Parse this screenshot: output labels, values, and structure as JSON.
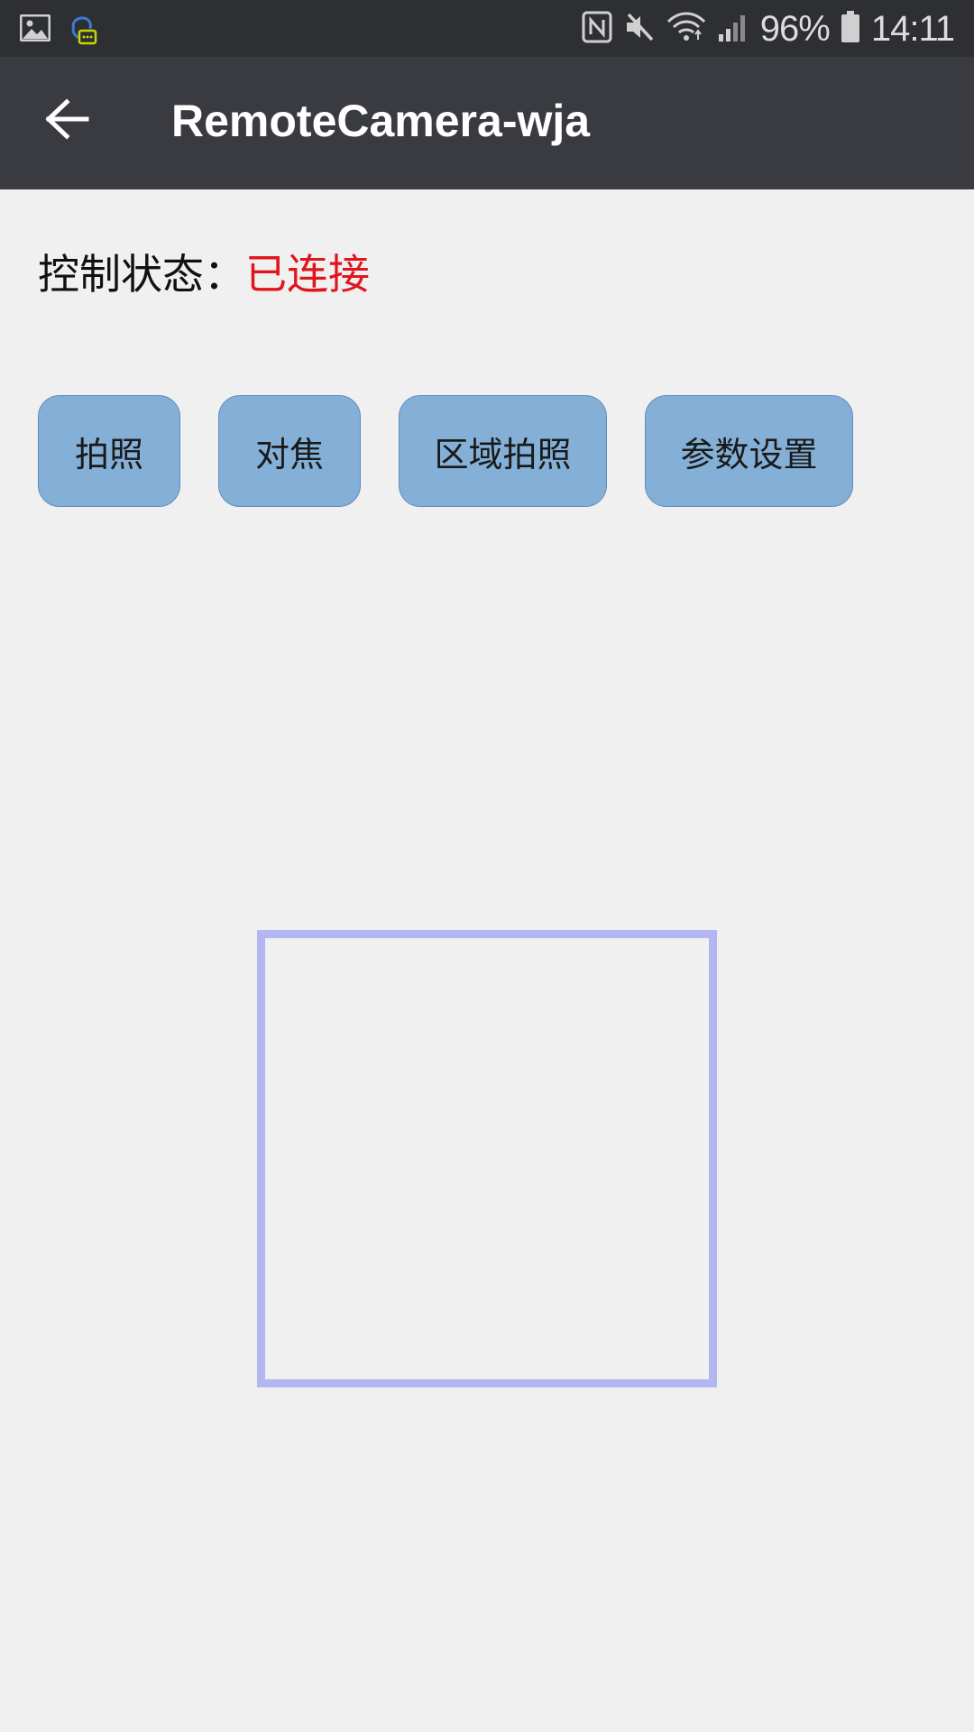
{
  "status_bar": {
    "battery_percent": "96%",
    "time": "14:11",
    "icons": [
      "gallery-icon",
      "chat-bot-icon",
      "nfc-icon",
      "mute-icon",
      "wifi-icon",
      "signal-icon",
      "battery-icon"
    ]
  },
  "app_bar": {
    "title": "RemoteCamera-wja",
    "back_icon": "arrow-left-icon"
  },
  "control": {
    "label": "控制状态：",
    "value": "已连接",
    "value_color": "#e0161e"
  },
  "buttons": {
    "take_photo": "拍照",
    "focus": "对焦",
    "area_photo": "区域拍照",
    "settings": "参数设置"
  },
  "colors": {
    "status_bar_bg": "#2d2f33",
    "app_bar_bg": "#393b40",
    "button_bg": "#84b0d8",
    "frame_border": "#b3b6f0",
    "page_bg": "#f0f0f0"
  }
}
